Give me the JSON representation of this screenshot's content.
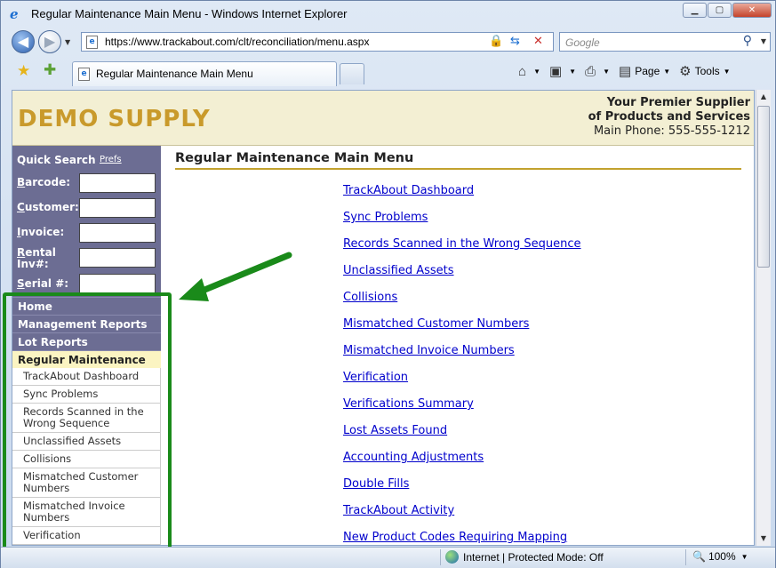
{
  "window": {
    "title": "Regular Maintenance Main Menu - Windows Internet Explorer",
    "controls": [
      "minimize-icon",
      "maximize-icon",
      "close-icon"
    ]
  },
  "address_bar": {
    "url": "https://www.trackabout.com/clt/reconciliation/menu.aspx",
    "search_placeholder": "Google"
  },
  "tabs": [
    {
      "title": "Regular Maintenance Main Menu"
    }
  ],
  "command_bar": {
    "page_label": "Page",
    "tools_label": "Tools"
  },
  "header": {
    "brand": "DEMO SUPPLY",
    "tagline_line1": "Your Premier Supplier",
    "tagline_line2": "of Products and Services",
    "phone": "Main Phone: 555-555-1212"
  },
  "quick_search": {
    "title": "Quick Search",
    "prefs": "Prefs",
    "fields": [
      {
        "first": "B",
        "rest": "arcode:"
      },
      {
        "first": "C",
        "rest": "ustomer:"
      },
      {
        "first": "I",
        "rest": "nvoice:"
      },
      {
        "first": "R",
        "rest": "ental Inv#:"
      },
      {
        "first": "S",
        "rest": "erial #:"
      }
    ]
  },
  "sidebar_menu": {
    "home": "Home",
    "management_reports": "Management Reports",
    "lot_reports": "Lot Reports",
    "regular_maintenance": "Regular Maintenance",
    "subitems": [
      "TrackAbout Dashboard",
      "Sync Problems",
      "Records Scanned in the Wrong Sequence",
      "Unclassified Assets",
      "Collisions",
      "Mismatched Customer Numbers",
      "Mismatched Invoice Numbers",
      "Verification"
    ]
  },
  "content": {
    "title": "Regular Maintenance Main Menu",
    "links": [
      "TrackAbout Dashboard",
      "Sync Problems",
      "Records Scanned in the Wrong Sequence",
      "Unclassified Assets",
      "Collisions",
      "Mismatched Customer Numbers",
      "Mismatched Invoice Numbers",
      "Verification",
      "Verifications Summary",
      "Lost Assets Found",
      "Accounting Adjustments",
      "Double Fills",
      "TrackAbout Activity",
      "New Product Codes Requiring Mapping"
    ]
  },
  "status_bar": {
    "zone": "Internet | Protected Mode: Off",
    "zoom": "100%"
  },
  "colors": {
    "brand": "#c99a2b",
    "sidebar": "#6c6d93",
    "active_menu": "#fbf4c2",
    "annotation": "#1a8a1a",
    "link": "#0000cc"
  }
}
